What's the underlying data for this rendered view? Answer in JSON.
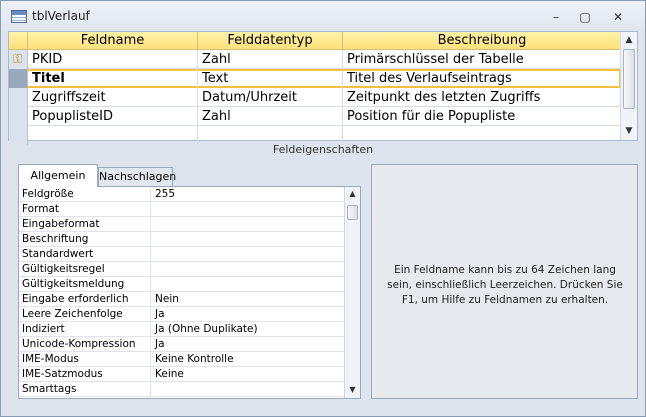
{
  "window": {
    "title": "tblVerlauf",
    "minimize": "–",
    "restore": "▢",
    "close": "✕"
  },
  "grid": {
    "headers": [
      "Feldname",
      "Felddatentyp",
      "Beschreibung"
    ],
    "rows": [
      {
        "name": "PKID",
        "type": "Zahl",
        "desc": "Primärschlüssel der Tabelle",
        "key": true
      },
      {
        "name": "Titel",
        "type": "Text",
        "desc": "Titel des Verlaufseintrags",
        "active": true
      },
      {
        "name": "Zugriffszeit",
        "type": "Datum/Uhrzeit",
        "desc": "Zeitpunkt des letzten Zugriffs"
      },
      {
        "name": "PopuplisteID",
        "type": "Zahl",
        "desc": "Position für die Popupliste"
      }
    ],
    "scroll_up": "▲",
    "scroll_down": "▼"
  },
  "field_properties_label": "Feldeigenschaften",
  "tabs": [
    "Allgemein",
    "Nachschlagen"
  ],
  "properties": [
    {
      "name": "Feldgröße",
      "value": "255"
    },
    {
      "name": "Format",
      "value": ""
    },
    {
      "name": "Eingabeformat",
      "value": ""
    },
    {
      "name": "Beschriftung",
      "value": ""
    },
    {
      "name": "Standardwert",
      "value": ""
    },
    {
      "name": "Gültigkeitsregel",
      "value": ""
    },
    {
      "name": "Gültigkeitsmeldung",
      "value": ""
    },
    {
      "name": "Eingabe erforderlich",
      "value": "Nein"
    },
    {
      "name": "Leere Zeichenfolge",
      "value": "Ja"
    },
    {
      "name": "Indiziert",
      "value": "Ja (Ohne Duplikate)"
    },
    {
      "name": "Unicode-Kompression",
      "value": "Ja"
    },
    {
      "name": "IME-Modus",
      "value": "Keine Kontrolle"
    },
    {
      "name": "IME-Satzmodus",
      "value": "Keine"
    },
    {
      "name": "Smarttags",
      "value": ""
    }
  ],
  "help_text": "Ein Feldname kann bis zu 64 Zeichen lang sein, einschließlich Leerzeichen. Drücken Sie F1, um Hilfe zu Feldnamen zu erhalten.",
  "colors": {
    "header_bg": "#fde07a",
    "active_outline": "#f5c040",
    "window_bg": "#dde4ee"
  }
}
